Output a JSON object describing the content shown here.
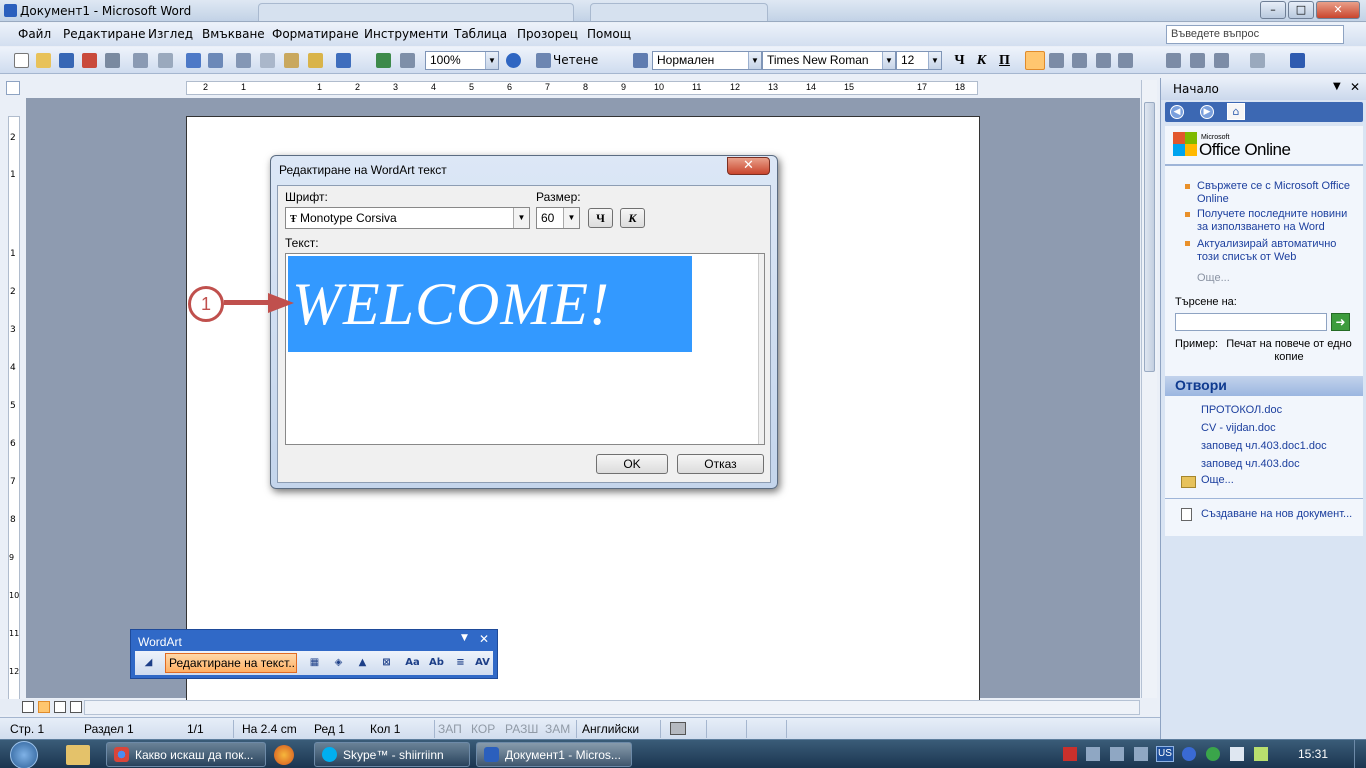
{
  "window": {
    "title": "Документ1 - Microsoft Word",
    "min": "–",
    "max": "□",
    "close": "✕"
  },
  "menu": {
    "items": [
      "Файл",
      "Редактиране",
      "Изглед",
      "Вмъкване",
      "Форматиране",
      "Инструменти",
      "Таблица",
      "Прозорец",
      "Помощ"
    ],
    "ask_placeholder": "Въведете въпрос"
  },
  "toolbar": {
    "zoom": "100%",
    "read_label": "Четене",
    "style": "Нормален",
    "font": "Times New Roman",
    "size": "12",
    "bold": "Ч",
    "italic": "К",
    "underline": "П"
  },
  "ruler": {
    "marks": [
      "2",
      "1",
      "1",
      "2",
      "3",
      "4",
      "5",
      "6",
      "7",
      "8",
      "9",
      "10",
      "11",
      "12",
      "13",
      "14",
      "15",
      "17",
      "18"
    ]
  },
  "vruler": {
    "marks": [
      "2",
      "1",
      "1",
      "2",
      "3",
      "4",
      "5",
      "6",
      "7",
      "8",
      "9",
      "10",
      "11",
      "12"
    ]
  },
  "dialog": {
    "title": "Редактиране на WordArt текст",
    "close": "✕",
    "font_label": "Шрифт:",
    "font_value": "Monotype Corsiva",
    "size_label": "Размер:",
    "size_value": "60",
    "bold": "Ч",
    "italic": "К",
    "text_label": "Текст:",
    "text_value": "WELCOME!",
    "ok": "OK",
    "cancel": "Отказ"
  },
  "callout": {
    "number": "1",
    "color": "#c0504d"
  },
  "wordart_toolbar": {
    "title": "WordArt",
    "edit_label": "Редактиране на текст...",
    "icon_text": [
      "Aa",
      "Ab",
      "AV"
    ]
  },
  "status": {
    "page": "Стр. 1",
    "section": "Раздел 1",
    "pages": "1/1",
    "at": "На 2.4 cm",
    "line": "Ред 1",
    "col": "Кол 1",
    "rec": "ЗАП",
    "trk": "КОР",
    "ext": "РАЗШ",
    "ovr": "ЗАМ",
    "lang": "Английски"
  },
  "taskpane": {
    "title": "Начало",
    "logo_small": "Microsoft",
    "logo": "Office Online",
    "links": [
      "Свържете се с Microsoft Office Online",
      "Получете последните новини за използването на Word",
      "Актуализирай автоматично този списък от Web"
    ],
    "more": "Още...",
    "search_label": "Търсене на:",
    "example_label": "Пример:",
    "example_text": "Печат на повече от едно копие",
    "open_section": "Отвори",
    "files": [
      "ПРОТОКОЛ.doc",
      "CV - vijdan.doc",
      "заповед чл.403.doc1.doc",
      "заповед чл.403.doc"
    ],
    "open_more": "Още...",
    "create_new": "Създаване на нов документ..."
  },
  "taskbar": {
    "items": [
      "Какво искаш да пок...",
      "Skype™ - shiirriinn",
      "Документ1 - Micros..."
    ],
    "lang": "US",
    "time": "15:31"
  }
}
